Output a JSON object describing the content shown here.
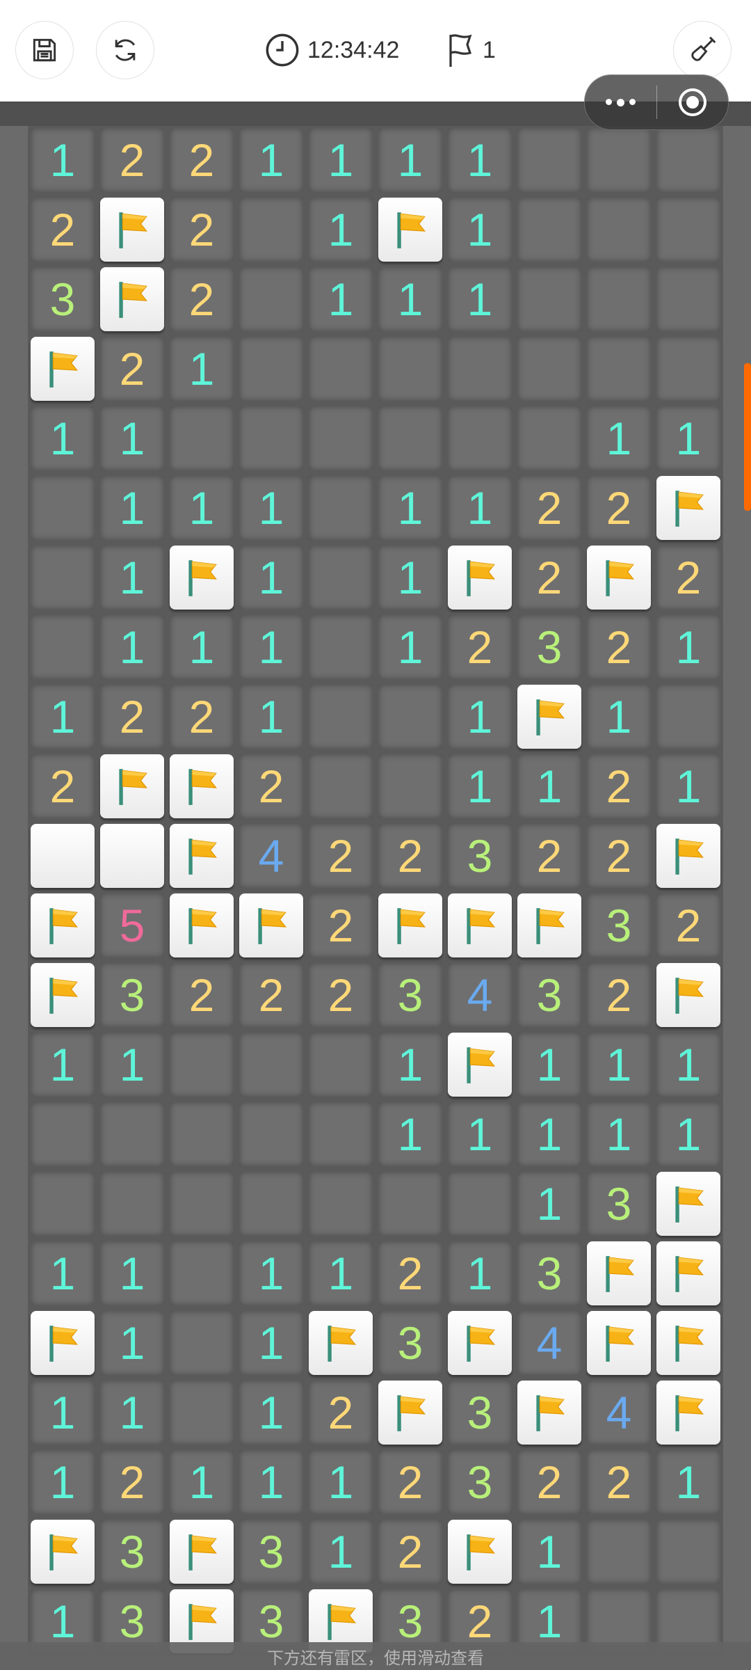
{
  "header": {
    "time": "12:34:42",
    "flag_count": "1"
  },
  "icons": {
    "save": "save-icon",
    "restart": "refresh-icon",
    "clock": "clock-icon",
    "flag": "flag-icon",
    "shovel": "shovel-icon",
    "more": "more-dots-icon",
    "close": "target-icon"
  },
  "colors": {
    "one": "#5ef5d9",
    "two": "#ffd878",
    "three": "#b8f07a",
    "four": "#6aaaf0",
    "five": "#f06a9a",
    "accent": "#ff6a00"
  },
  "board": {
    "rows": [
      [
        "1",
        "2",
        "2",
        "1",
        "1",
        "1",
        "1",
        "",
        "",
        ""
      ],
      [
        "2",
        "F",
        "2",
        "",
        "1",
        "F",
        "1",
        "",
        "",
        ""
      ],
      [
        "3",
        "F",
        "2",
        "",
        "1",
        "1",
        "1",
        "",
        "",
        ""
      ],
      [
        "F",
        "2",
        "1",
        "",
        "",
        "",
        "",
        "",
        "",
        ""
      ],
      [
        "1",
        "1",
        "",
        "",
        "",
        "",
        "",
        "",
        "1",
        "1"
      ],
      [
        "",
        "1",
        "1",
        "1",
        "",
        "1",
        "1",
        "2",
        "2",
        "F"
      ],
      [
        "",
        "1",
        "F",
        "1",
        "",
        "1",
        "F",
        "2",
        "F",
        "2"
      ],
      [
        "",
        "1",
        "1",
        "1",
        "",
        "1",
        "2",
        "3",
        "2",
        "1"
      ],
      [
        "1",
        "2",
        "2",
        "1",
        "",
        "",
        "1",
        "F",
        "1",
        ""
      ],
      [
        "2",
        "F",
        "F",
        "2",
        "",
        "",
        "1",
        "1",
        "2",
        "1"
      ],
      [
        "H",
        "H",
        "F",
        "4",
        "2",
        "2",
        "3",
        "2",
        "2",
        "F"
      ],
      [
        "F",
        "5",
        "F",
        "F",
        "2",
        "F",
        "F",
        "F",
        "3",
        "2"
      ],
      [
        "F",
        "3",
        "2",
        "2",
        "2",
        "3",
        "4",
        "3",
        "2",
        "F"
      ],
      [
        "1",
        "1",
        "",
        "",
        "",
        "1",
        "F",
        "1",
        "1",
        "1"
      ],
      [
        "",
        "",
        "",
        "",
        "",
        "1",
        "1",
        "1",
        "1",
        "1"
      ],
      [
        "",
        "",
        "",
        "",
        "",
        "",
        "",
        "1",
        "3",
        "F"
      ],
      [
        "1",
        "1",
        "",
        "1",
        "1",
        "2",
        "1",
        "3",
        "F",
        "F"
      ],
      [
        "F",
        "1",
        "",
        "1",
        "F",
        "3",
        "F",
        "4",
        "F",
        "F"
      ],
      [
        "1",
        "1",
        "",
        "1",
        "2",
        "F",
        "3",
        "F",
        "4",
        "F"
      ],
      [
        "1",
        "2",
        "1",
        "1",
        "1",
        "2",
        "3",
        "2",
        "2",
        "1"
      ],
      [
        "F",
        "3",
        "F",
        "3",
        "1",
        "2",
        "F",
        "1",
        "",
        ""
      ],
      [
        "1",
        "3",
        "F",
        "3",
        "F",
        "3",
        "2",
        "1",
        "",
        ""
      ]
    ]
  },
  "footer": {
    "hint": "下方还有雷区，使用滑动查看"
  }
}
